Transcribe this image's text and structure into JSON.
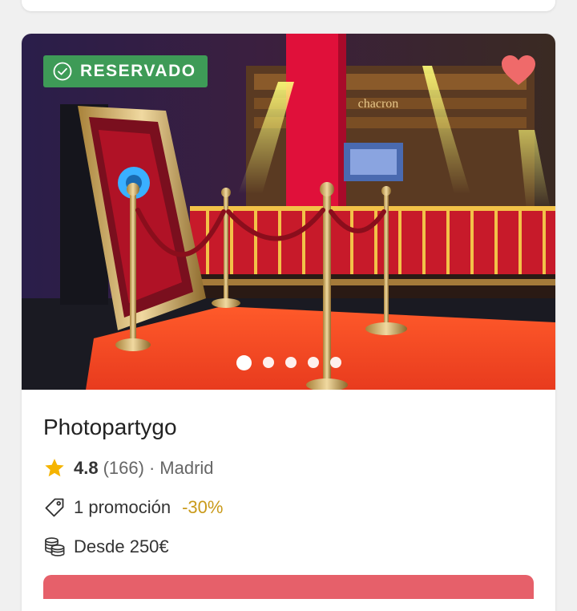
{
  "listing": {
    "badge": "RESERVADO",
    "name": "Photopartygo",
    "rating": "4.8",
    "reviews": "(166)",
    "separator": "·",
    "location": "Madrid",
    "promo": "1 promoción",
    "discount": "-30%",
    "price": "Desde 250€",
    "carousel_total": 5,
    "carousel_active": 1,
    "favorited": true
  },
  "photo_sign": "chacron",
  "icons": {
    "badge": "check-circle-icon",
    "favorite": "heart-icon",
    "rating": "star-icon",
    "promo": "tag-icon",
    "price": "coins-icon"
  },
  "colors": {
    "badge": "#3e9b57",
    "heart": "#ef6a6a",
    "star": "#f5b400",
    "discount": "#c99a1a",
    "cta": "#e6606a"
  }
}
